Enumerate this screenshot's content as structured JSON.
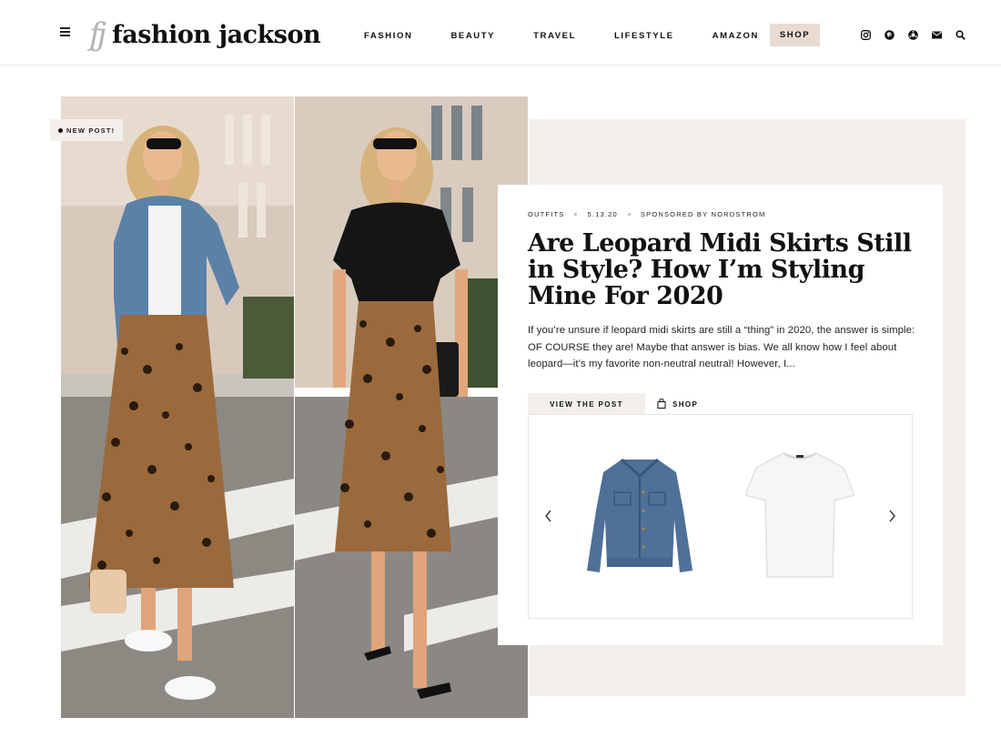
{
  "header": {
    "logo_mark": "fj",
    "logo_text": "fashion jackson",
    "nav": [
      "FASHION",
      "BEAUTY",
      "TRAVEL",
      "LIFESTYLE",
      "AMAZON"
    ],
    "shop_label": "SHOP",
    "social_icons": [
      "instagram-icon",
      "pinterest-icon",
      "liketoknowit-icon",
      "email-icon",
      "search-icon"
    ]
  },
  "hero": {
    "badge": "NEW POST!",
    "meta": {
      "category": "OUTFITS",
      "date": "5.13.20",
      "sponsor": "SPONSORED BY NORDSTROM"
    },
    "title": "Are Leopard Midi Skirts Still in Style? How I’m Styling Mine For 2020",
    "excerpt": "If you’re unsure if leopard midi skirts are still a “thing” in 2020, the answer is simple: OF COURSE they are! Maybe that answer is bias. We all know how I feel about leopard—it’s my favorite non-neutral neutral! However, I...",
    "view_post_label": "VIEW THE POST",
    "shop_tab_label": "SHOP",
    "products": [
      "denim-jacket",
      "white-tee"
    ]
  },
  "colors": {
    "accent_beige": "#e8dcd2",
    "panel_beige": "#f3f0ec",
    "text": "#111111"
  }
}
